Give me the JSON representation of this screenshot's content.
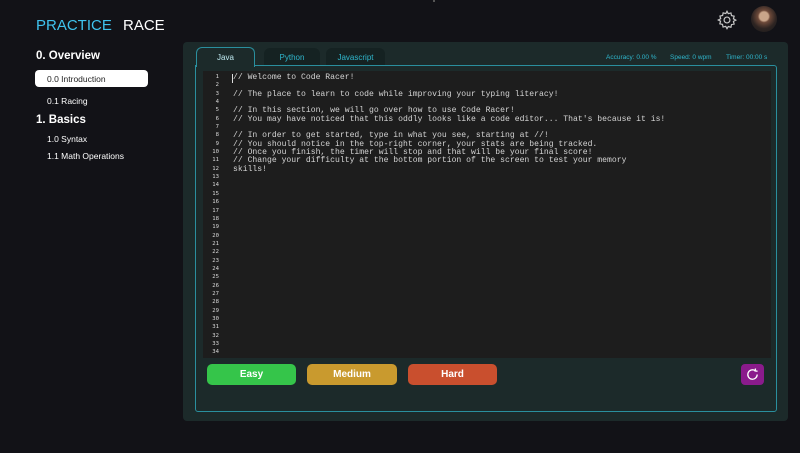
{
  "nav": {
    "practice": "PRACTICE",
    "race": "RACE"
  },
  "sidebar": {
    "sections": [
      {
        "title": "0. Overview",
        "items": [
          "0.0 Introduction",
          "0.1 Racing"
        ]
      },
      {
        "title": "1. Basics",
        "items": [
          "1.0 Syntax",
          "1.1 Math Operations"
        ]
      }
    ]
  },
  "tabs": [
    "Java",
    "Python",
    "Javascript"
  ],
  "stats": {
    "accuracy": "Accuracy: 0.00 %",
    "speed": "Speed: 0 wpm",
    "timer": "Timer: 00:00 s"
  },
  "editor": {
    "line_numbers": [
      "1",
      "2",
      "3",
      "4",
      "5",
      "6",
      "7",
      "8",
      "9",
      "10",
      "11",
      "12",
      "13",
      "14",
      "15",
      "16",
      "17",
      "18",
      "19",
      "20",
      "21",
      "22",
      "23",
      "24",
      "25",
      "26",
      "27",
      "28",
      "29",
      "30",
      "31",
      "32",
      "33",
      "34"
    ],
    "code_lines": [
      "// Welcome to Code Racer!",
      "",
      "// The place to learn to code while improving your typing literacy!",
      "",
      "// In this section, we will go over how to use Code Racer!",
      "// You may have noticed that this oddly looks like a code editor... That's because it is!",
      "",
      "// In order to get started, type in what you see, starting at //!",
      "// You should notice in the top-right corner, your stats are being tracked.",
      "// Once you finish, the timer will stop and that will be your final score!",
      "// Change your difficulty at the bottom portion of the screen to test your memory",
      "skills!"
    ]
  },
  "difficulty": {
    "easy": "Easy",
    "medium": "Medium",
    "hard": "Hard"
  },
  "colors": {
    "accent": "#3fc3ee",
    "easy": "#35c54a",
    "medium": "#c99a2e",
    "hard": "#c94f2e",
    "reset": "#8a1b8c"
  },
  "icons": {
    "settings": "gear-icon",
    "profile": "avatar",
    "reset": "refresh-icon"
  }
}
